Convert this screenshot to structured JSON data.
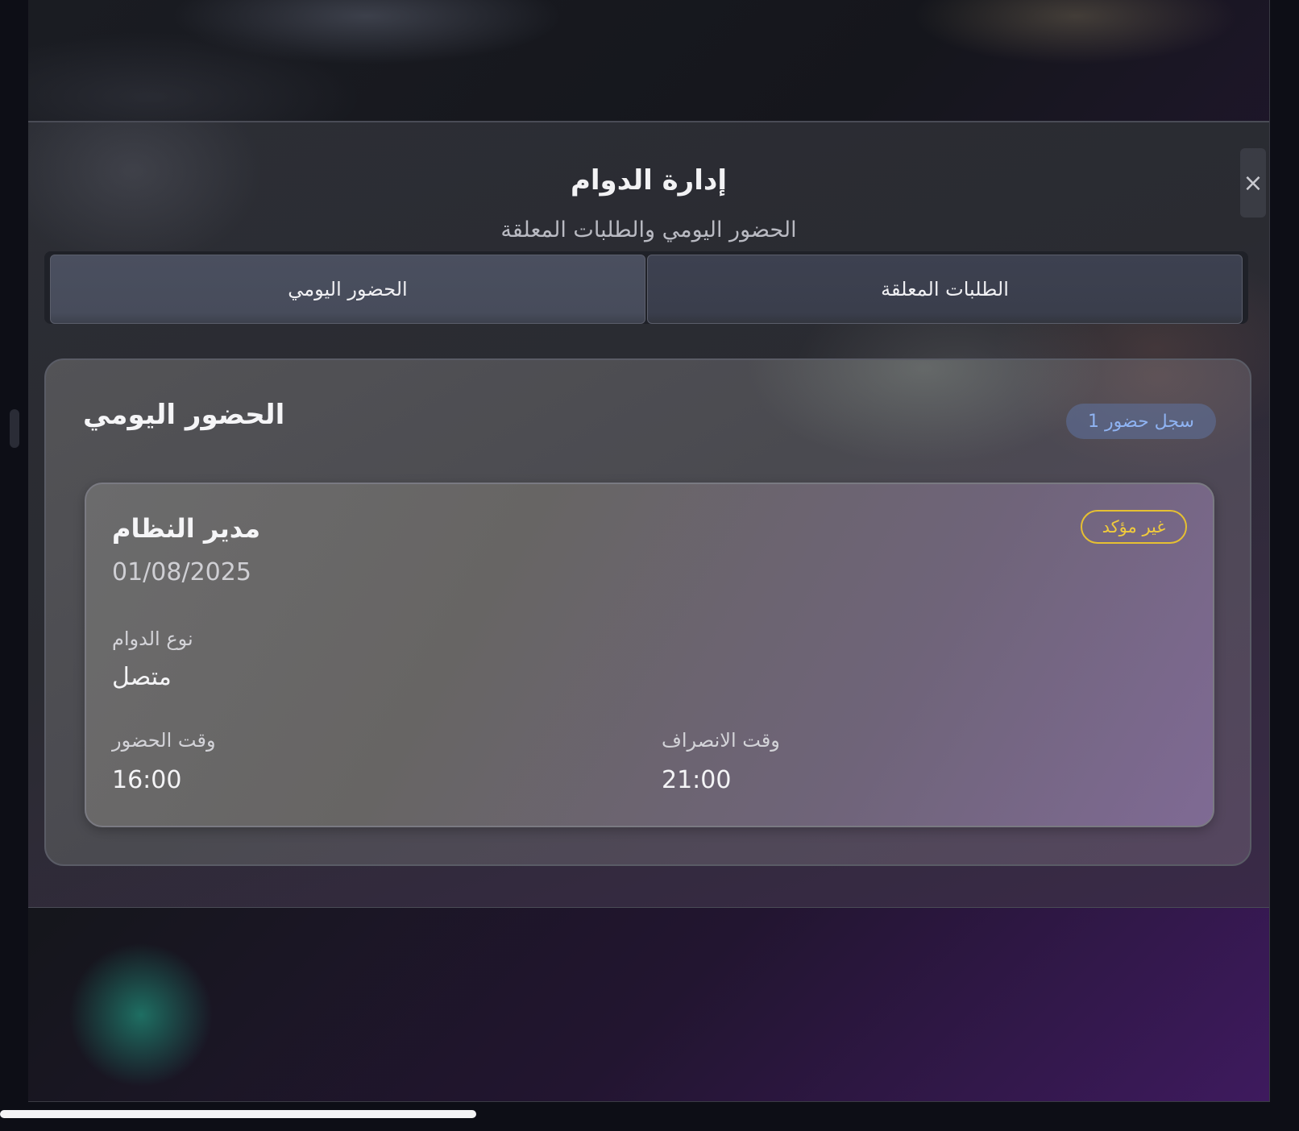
{
  "modal": {
    "title": "إدارة الدوام",
    "subtitle": "الحضور اليومي والطلبات المعلقة",
    "close_icon": "×"
  },
  "tabs": [
    {
      "label": "الطلبات المعلقة",
      "active": false
    },
    {
      "label": "الحضور اليومي",
      "active": true
    }
  ],
  "panel": {
    "title": "الحضور اليومي",
    "count_badge": "سجل حضور 1"
  },
  "record": {
    "employee_name": "مدير النظام",
    "date": "01/08/2025",
    "status": "غير مؤكد",
    "work_type_label": "نوع الدوام",
    "work_type_value": "متصل",
    "check_in_label": "وقت الحضور",
    "check_in_value": "16:00",
    "check_out_label": "وقت الانصراف",
    "check_out_value": "21:00"
  },
  "colors": {
    "status_pending": "#f1cb3c",
    "count_badge_text": "#8fb3f2"
  }
}
